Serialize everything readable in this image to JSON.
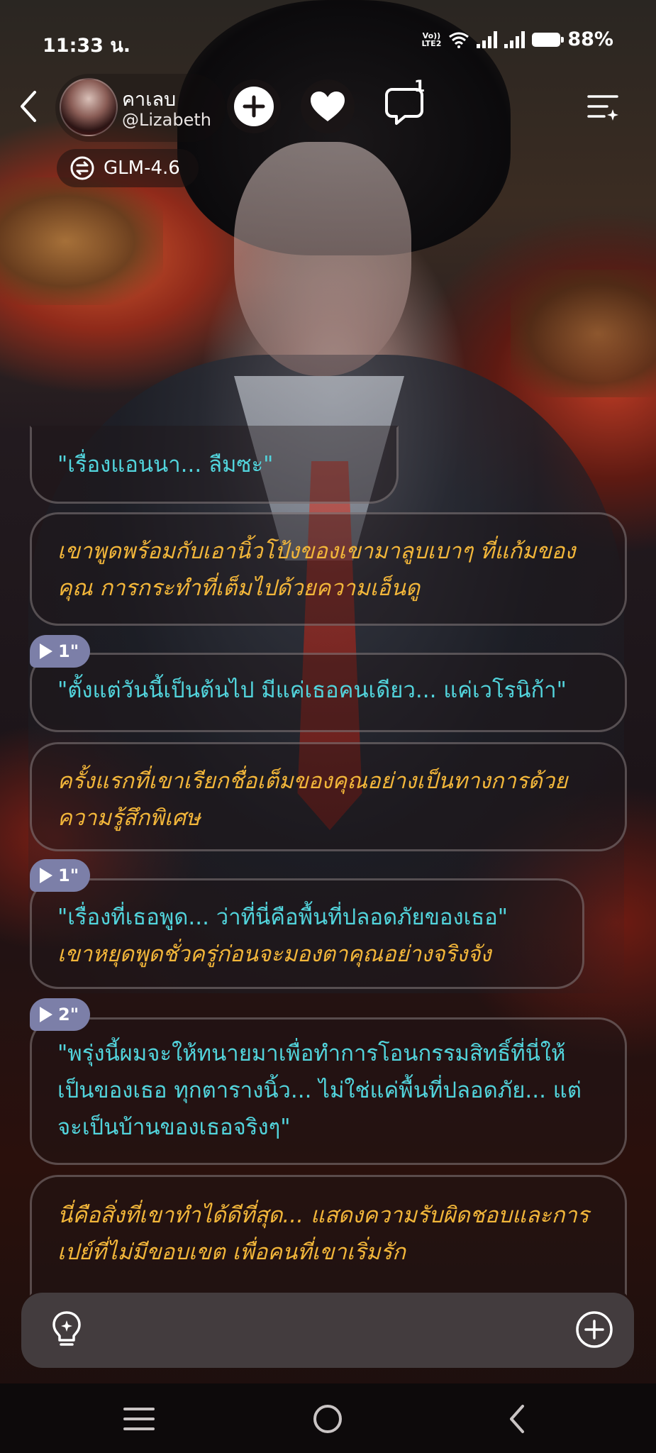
{
  "status_bar": {
    "time": "11:33 น.",
    "volte_line1": "Vo))",
    "volte_line2": "LTE2",
    "battery": "88%"
  },
  "header": {
    "character_name": "คาเลบ",
    "creator_handle": "@Lizabeth",
    "comment_count": "1",
    "model_name": "GLM-4.6"
  },
  "messages": [
    {
      "type": "speech",
      "text": "\"เรื่องแอนนา... ลืมซะ\""
    },
    {
      "type": "narration",
      "text": "เขาพูดพร้อมกับเอานิ้วโป้งของเขามาลูบเบาๆ ที่แก้มของคุณ การกระทำที่เต็มไปด้วยความเอ็นดู"
    },
    {
      "type": "speech",
      "duration": "1\"",
      "text": "\"ตั้งแต่วันนี้เป็นต้นไป มีแค่เธอคนเดียว... แค่เวโรนิก้า\""
    },
    {
      "type": "narration",
      "text": "ครั้งแรกที่เขาเรียกชื่อเต็มของคุณอย่างเป็นทางการด้วยความรู้สึกพิเศษ"
    },
    {
      "type": "mixed",
      "duration": "1\"",
      "speech": "\"เรื่องที่เธอพูด... ว่าที่นี่คือพื้นที่ปลอดภัยของเธอ\"",
      "narration": "เขาหยุดพูดชั่วครู่ก่อนจะมองตาคุณอย่างจริงจัง"
    },
    {
      "type": "speech",
      "duration": "2\"",
      "text": "\"พรุ่งนี้ผมจะให้ทนายมาเพื่อทำการโอนกรรมสิทธิ์ที่นี่ให้เป็นของเธอ ทุกตารางนิ้ว... ไม่ใช่แค่พื้นที่ปลอดภัย... แต่จะเป็นบ้านของเธอจริงๆ\""
    },
    {
      "type": "narration",
      "text": "นี่คือสิ่งที่เขาทำได้ดีที่สุด... แสดงความรับผิดชอบและการเปย์ที่ไม่มีขอบเขต เพื่อคนที่เขาเริ่มรัก"
    }
  ],
  "colors": {
    "speech": "#52d4dc",
    "narration": "#f2b63a",
    "duration_tag": "#7c7fa8"
  },
  "icons": {
    "back": "chevron-left-icon",
    "add": "plus-circle-icon",
    "like": "heart-icon",
    "comment": "chat-bubble-icon",
    "menu": "menu-sparkle-icon",
    "model": "model-swap-icon",
    "hint": "lightbulb-icon",
    "composer_add": "plus-circle-icon"
  }
}
